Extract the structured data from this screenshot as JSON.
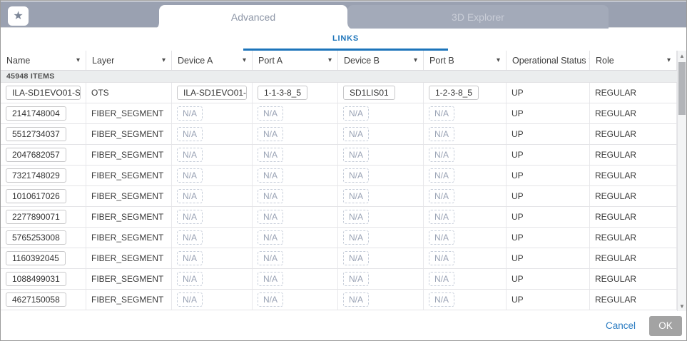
{
  "window": {
    "tabs": [
      {
        "label": "Advanced",
        "active": true
      },
      {
        "label": "3D Explorer",
        "active": false
      }
    ],
    "icons": {
      "favorite": "★",
      "caret_down": "▾",
      "scroll_up": "▲",
      "scroll_down": "▼"
    }
  },
  "links_tab": {
    "label": "LINKS"
  },
  "table": {
    "items_count": "45948 ITEMS",
    "na_text": "N/A",
    "columns": [
      "Name",
      "Layer",
      "Device A",
      "Port A",
      "Device B",
      "Port B",
      "Operational Status",
      "Role"
    ],
    "rows": [
      {
        "name": "ILA-SD1EVO01-S...",
        "layer": "OTS",
        "device_a": "ILA-SD1EVO01-S...",
        "port_a": "1-1-3-8_5",
        "device_b": "SD1LIS01",
        "port_b": "1-2-3-8_5",
        "status": "UP",
        "role": "REGULAR"
      },
      {
        "name": "2141748004",
        "layer": "FIBER_SEGMENT",
        "device_a": "N/A",
        "port_a": "N/A",
        "device_b": "N/A",
        "port_b": "N/A",
        "status": "UP",
        "role": "REGULAR"
      },
      {
        "name": "5512734037",
        "layer": "FIBER_SEGMENT",
        "device_a": "N/A",
        "port_a": "N/A",
        "device_b": "N/A",
        "port_b": "N/A",
        "status": "UP",
        "role": "REGULAR"
      },
      {
        "name": "2047682057",
        "layer": "FIBER_SEGMENT",
        "device_a": "N/A",
        "port_a": "N/A",
        "device_b": "N/A",
        "port_b": "N/A",
        "status": "UP",
        "role": "REGULAR"
      },
      {
        "name": "7321748029",
        "layer": "FIBER_SEGMENT",
        "device_a": "N/A",
        "port_a": "N/A",
        "device_b": "N/A",
        "port_b": "N/A",
        "status": "UP",
        "role": "REGULAR"
      },
      {
        "name": "1010617026",
        "layer": "FIBER_SEGMENT",
        "device_a": "N/A",
        "port_a": "N/A",
        "device_b": "N/A",
        "port_b": "N/A",
        "status": "UP",
        "role": "REGULAR"
      },
      {
        "name": "2277890071",
        "layer": "FIBER_SEGMENT",
        "device_a": "N/A",
        "port_a": "N/A",
        "device_b": "N/A",
        "port_b": "N/A",
        "status": "UP",
        "role": "REGULAR"
      },
      {
        "name": "5765253008",
        "layer": "FIBER_SEGMENT",
        "device_a": "N/A",
        "port_a": "N/A",
        "device_b": "N/A",
        "port_b": "N/A",
        "status": "UP",
        "role": "REGULAR"
      },
      {
        "name": "1160392045",
        "layer": "FIBER_SEGMENT",
        "device_a": "N/A",
        "port_a": "N/A",
        "device_b": "N/A",
        "port_b": "N/A",
        "status": "UP",
        "role": "REGULAR"
      },
      {
        "name": "1088499031",
        "layer": "FIBER_SEGMENT",
        "device_a": "N/A",
        "port_a": "N/A",
        "device_b": "N/A",
        "port_b": "N/A",
        "status": "UP",
        "role": "REGULAR"
      },
      {
        "name": "4627150058",
        "layer": "FIBER_SEGMENT",
        "device_a": "N/A",
        "port_a": "N/A",
        "device_b": "N/A",
        "port_b": "N/A",
        "status": "UP",
        "role": "REGULAR"
      }
    ]
  },
  "footer": {
    "cancel": "Cancel",
    "ok": "OK"
  },
  "colors": {
    "accent_blue": "#1c74ba",
    "topbar_gray": "#9aa1b1",
    "ok_button_gray": "#a3a3a3"
  }
}
